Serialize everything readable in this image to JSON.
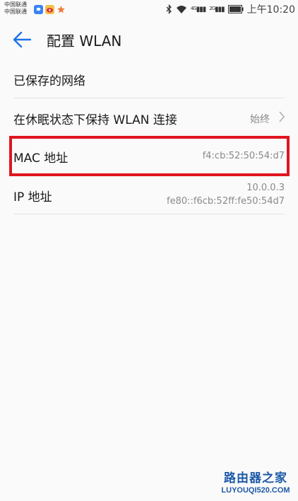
{
  "status_bar": {
    "carrier_1": "中国联通",
    "carrier_2": "中国联通",
    "time": "上午10:20",
    "network_1": "4G",
    "network_2": "2G",
    "notification_icons": [
      "social-app-icon",
      "weibo-icon",
      "star-app-icon"
    ]
  },
  "header": {
    "title": "配置 WLAN",
    "back_icon": "back-arrow-icon"
  },
  "settings": {
    "saved_networks": {
      "label": "已保存的网络"
    },
    "sleep_wlan": {
      "label": "在休眠状态下保持 WLAN 连接",
      "value": "始终"
    },
    "mac_address": {
      "label": "MAC 地址",
      "value": "f4:cb:52:50:54:d7"
    },
    "ip_address": {
      "label": "IP 地址",
      "ipv4": "10.0.0.3",
      "ipv6": "fe80::f6cb:52ff:fe50:54d7"
    }
  },
  "watermark": {
    "title": "路由器之家",
    "url": "LUYOUQI520.COM"
  },
  "colors": {
    "accent": "#1a73e8",
    "highlight": "#e0151f",
    "secondary_text": "#8a8a8a"
  }
}
